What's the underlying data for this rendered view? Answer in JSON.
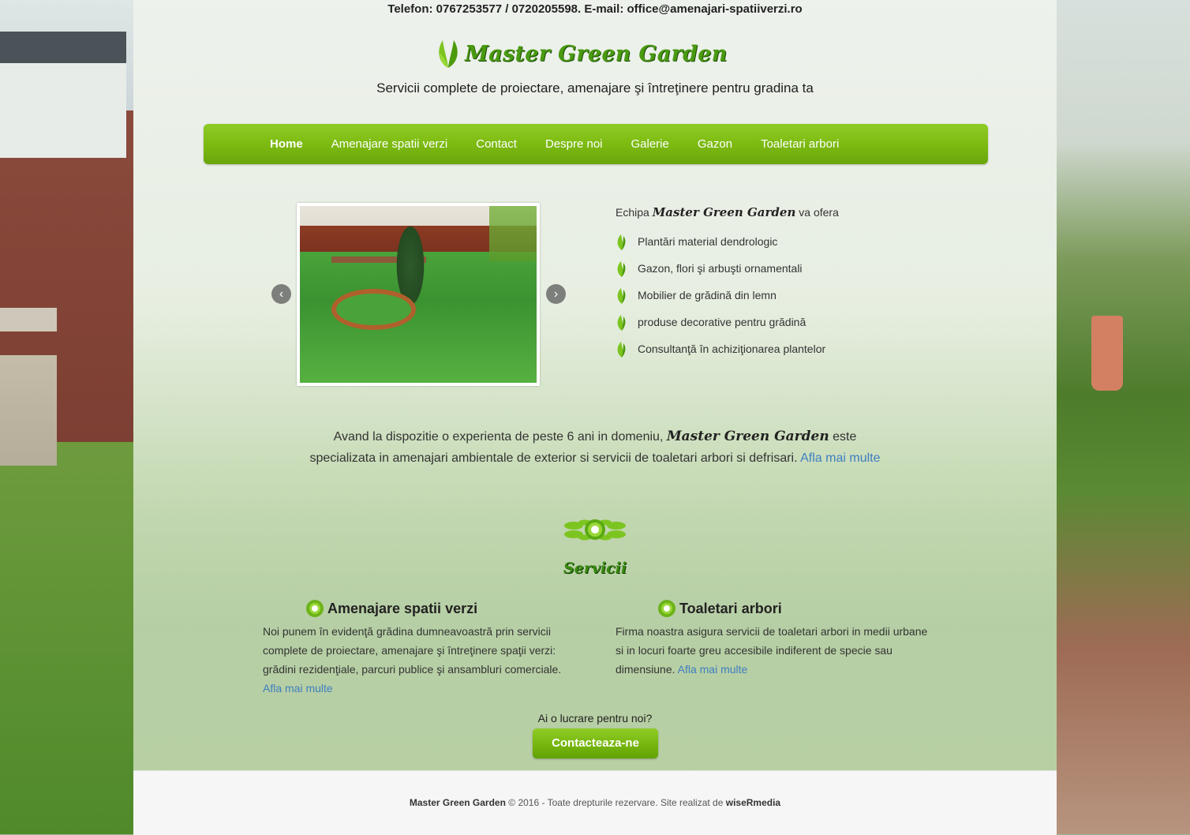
{
  "contact_bar": {
    "text": "Telefon: 0767253577 / 0720205598. E-mail: office@amenajari-spatiiverzi.ro"
  },
  "brand": {
    "name": "Master Green Garden",
    "logo_icon": "leaf-icon"
  },
  "tagline": "Servicii complete de proiectare, amenajare şi întreţinere pentru gradina ta",
  "nav": {
    "items": [
      {
        "label": "Home",
        "active": true
      },
      {
        "label": "Amenajare spatii verzi"
      },
      {
        "label": "Contact"
      },
      {
        "label": "Despre noi"
      },
      {
        "label": "Galerie"
      },
      {
        "label": "Gazon"
      },
      {
        "label": "Toaletari arbori"
      }
    ]
  },
  "slider": {
    "prev_icon": "chevron-left-icon",
    "next_icon": "chevron-right-icon"
  },
  "offer": {
    "intro_before": "Echipa",
    "intro_brand": "Master Green Garden",
    "intro_after": "va ofera",
    "items": [
      "Plantări material dendrologic",
      "Gazon, flori şi arbuşti ornamentali",
      "Mobilier de grădină din lemn",
      "produse decorative pentru grădină",
      "Consultanţă în achiziţionarea plantelor"
    ]
  },
  "about": {
    "before": "Avand la dispozitie o experienta de peste 6 ani in domeniu,",
    "brand": "Master Green Garden",
    "after": "este specializata in amenajari ambientale de exterior si servicii de toaletari arbori si defrisari.",
    "link": "Afla mai multe"
  },
  "services": {
    "title": "Servicii",
    "items": [
      {
        "title": "Amenajare spatii verzi",
        "text": "Noi punem în evidenţă grădina dumneavoastră prin servicii complete de proiectare, amenajare şi întreţinere spaţii verzi: grădini rezidenţiale, parcuri publice şi ansambluri comerciale.",
        "link": "Afla mai multe"
      },
      {
        "title": "Toaletari arbori",
        "text": "Firma noastra asigura servicii de toaletari arbori in medii urbane si in locuri foarte greu accesibile indiferent de specie sau dimensiune.",
        "link": "Afla mai multe"
      }
    ]
  },
  "cta": {
    "question": "Ai o lucrare pentru noi?",
    "button": "Contacteaza-ne"
  },
  "footer": {
    "brand": "Master Green Garden",
    "text": "© 2016 - Toate drepturile rezervare. Site realizat de",
    "author": "wiseRmedia"
  },
  "colors": {
    "accent": "#7dbb12",
    "link": "#3f7ec2",
    "brand_text": "#4a9a12"
  }
}
